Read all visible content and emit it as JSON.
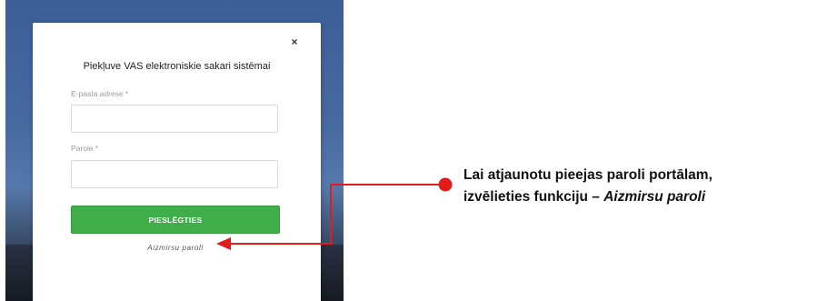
{
  "modal": {
    "title": "Piekļuve VAS elektroniskie sakari sistēmai",
    "close_glyph": "×",
    "email_label": "E-pasta adrese *",
    "email_value": "",
    "password_label": "Parole *",
    "password_value": "",
    "login_button": "PIESLĒGTIES",
    "forgot_link": "Aizmirsu paroli",
    "button_color": "#3fae49"
  },
  "annotation": {
    "line1": "Lai atjaunotu pieejas paroli portālam,",
    "line2_prefix": "izvēlieties funkciju – ",
    "line2_emphasis": "Aizmirsu paroli",
    "pointer_color": "#e21b1b"
  }
}
